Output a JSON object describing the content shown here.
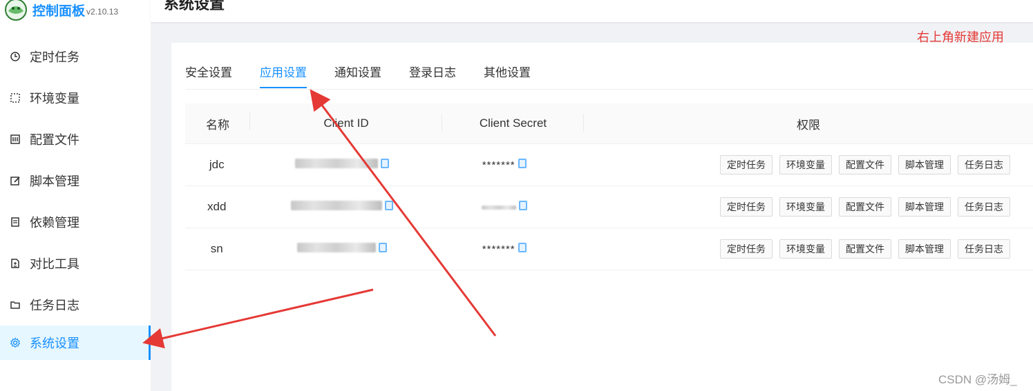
{
  "brand": {
    "title": "控制面板",
    "version": "v2.10.13"
  },
  "sidebar": {
    "items": [
      {
        "label": "定时任务",
        "icon": "clock-icon"
      },
      {
        "label": "环境变量",
        "icon": "dashed-square-icon"
      },
      {
        "label": "配置文件",
        "icon": "sliders-icon"
      },
      {
        "label": "脚本管理",
        "icon": "edit-icon"
      },
      {
        "label": "依赖管理",
        "icon": "book-icon"
      },
      {
        "label": "对比工具",
        "icon": "diff-icon"
      },
      {
        "label": "任务日志",
        "icon": "folder-icon"
      },
      {
        "label": "系统设置",
        "icon": "gear-icon",
        "active": true
      }
    ]
  },
  "header": {
    "title": "系统设置"
  },
  "annotation": "右上角新建应用",
  "tabs": [
    "安全设置",
    "应用设置",
    "通知设置",
    "登录日志",
    "其他设置"
  ],
  "active_tab": "应用设置",
  "table": {
    "columns": [
      "名称",
      "Client ID",
      "Client Secret",
      "权限"
    ],
    "rows": [
      {
        "name": "jdc",
        "client_secret": "*******",
        "permissions": [
          "定时任务",
          "环境变量",
          "配置文件",
          "脚本管理",
          "任务日志"
        ]
      },
      {
        "name": "xdd",
        "client_secret": "",
        "permissions": [
          "定时任务",
          "环境变量",
          "配置文件",
          "脚本管理",
          "任务日志"
        ]
      },
      {
        "name": "sn",
        "client_secret": "*******",
        "permissions": [
          "定时任务",
          "环境变量",
          "配置文件",
          "脚本管理",
          "任务日志"
        ]
      }
    ]
  },
  "watermark": "CSDN @汤姆_",
  "colors": {
    "accent": "#1890ff",
    "annotation": "#e53935",
    "active_bg": "#e6f7ff"
  }
}
